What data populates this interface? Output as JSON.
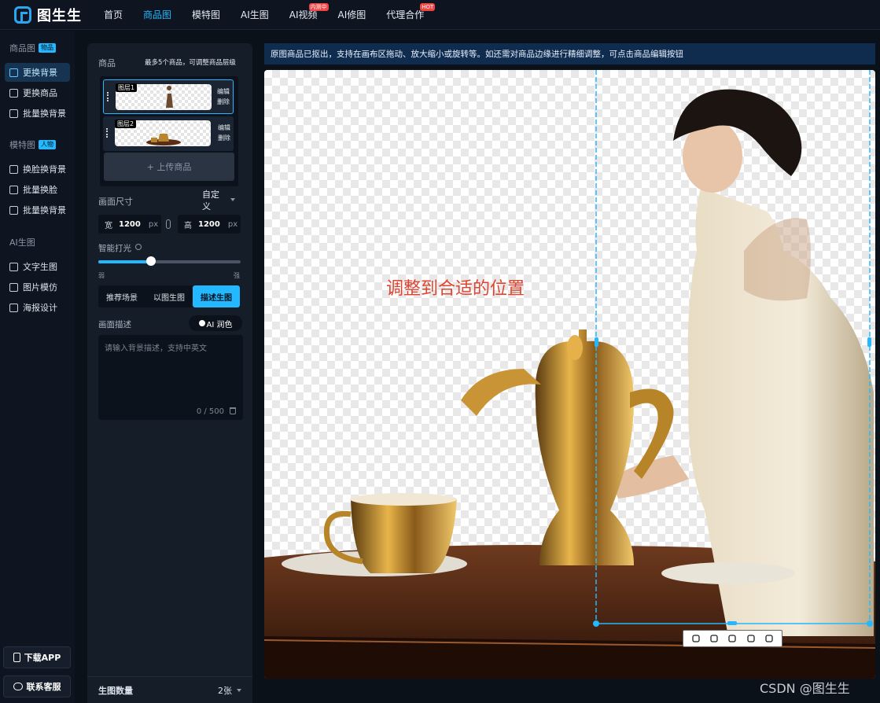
{
  "app": {
    "name": "图生生",
    "brand_color": "#23b8ff"
  },
  "nav": {
    "items": [
      {
        "label": "首页",
        "active": false,
        "tag": ""
      },
      {
        "label": "商品图",
        "active": true,
        "tag": ""
      },
      {
        "label": "模特图",
        "active": false,
        "tag": ""
      },
      {
        "label": "AI生图",
        "active": false,
        "tag": ""
      },
      {
        "label": "AI视频",
        "active": false,
        "tag": "内测中"
      },
      {
        "label": "AI修图",
        "active": false,
        "tag": ""
      },
      {
        "label": "代理合作",
        "active": false,
        "tag": "HOT"
      }
    ]
  },
  "sidebar": {
    "sections": [
      {
        "title": "商品图",
        "badge": "物品",
        "items": [
          {
            "label": "更换背景",
            "icon": "change-background-icon",
            "active": true
          },
          {
            "label": "更换商品",
            "icon": "swap-product-icon",
            "active": false
          },
          {
            "label": "批量换背景",
            "icon": "batch-background-icon",
            "active": false
          }
        ]
      },
      {
        "title": "模特图",
        "badge": "人物",
        "items": [
          {
            "label": "换脸换背景",
            "icon": "face-swap-icon",
            "active": false
          },
          {
            "label": "批量换脸",
            "icon": "batch-face-icon",
            "active": false
          },
          {
            "label": "批量换背景",
            "icon": "batch-background-icon",
            "active": false
          }
        ]
      },
      {
        "title": "AI生图",
        "badge": "",
        "items": [
          {
            "label": "文字生图",
            "icon": "text-to-image-icon",
            "active": false
          },
          {
            "label": "图片模仿",
            "icon": "image-imitate-icon",
            "active": false
          },
          {
            "label": "海报设计",
            "icon": "poster-icon",
            "active": false
          }
        ]
      }
    ],
    "download_app": "下载APP",
    "contact": "联系客服"
  },
  "panel": {
    "products_label": "商品",
    "products_hint": "最多5个商品，可调整商品层级",
    "layers": [
      {
        "name": "图层1",
        "edit": "编辑",
        "delete": "删除",
        "selected": true
      },
      {
        "name": "图层2",
        "edit": "编辑",
        "delete": "删除",
        "selected": false
      }
    ],
    "upload_label": "+ 上传商品",
    "canvas_size_label": "画面尺寸",
    "size_preset": "自定义",
    "width_label": "宽",
    "width_value": "1200",
    "height_label": "高",
    "height_value": "1200",
    "unit": "px",
    "lighting_label": "智能打光",
    "lighting_level": 0.37,
    "lighting_min": "弱",
    "lighting_max": "强",
    "tabs": [
      {
        "label": "推荐场景",
        "active": false
      },
      {
        "label": "以图生图",
        "active": false
      },
      {
        "label": "描述生图",
        "active": true
      }
    ],
    "desc_label": "画面描述",
    "ai_polish": "AI 润色",
    "desc_placeholder": "请输入背景描述，支持中英文",
    "desc_value": "",
    "char_count": "0 / 500",
    "gen_count_label": "生图数量",
    "gen_count_value": "2张"
  },
  "notice": "原图商品已抠出，支持在画布区拖动、放大缩小或旋转等。如还需对商品边缘进行精细调整，可点击商品编辑按钮",
  "canvas": {
    "hint_text": "调整到合适的位置",
    "toolbar": [
      "crop-icon",
      "flip-icon",
      "rotate-icon",
      "layer-up-icon",
      "layer-down-icon"
    ]
  },
  "watermark": "CSDN @图生生"
}
